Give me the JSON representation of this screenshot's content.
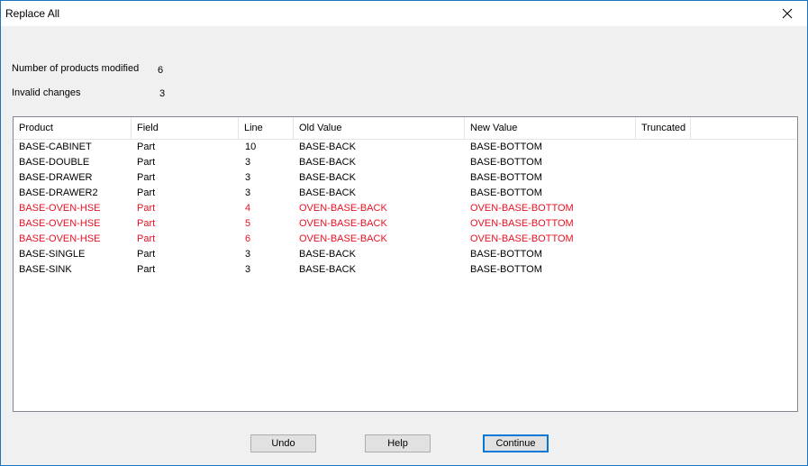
{
  "window": {
    "title": "Replace All"
  },
  "summary": {
    "modified_label": "Number of products modified",
    "modified_value": "6",
    "invalid_label": "Invalid changes",
    "invalid_value": "3"
  },
  "table": {
    "columns": [
      "Product",
      "Field",
      "Line",
      "Old Value",
      "New Value",
      "Truncated"
    ],
    "rows": [
      {
        "product": "BASE-CABINET",
        "field": "Part",
        "line": "10",
        "old": "BASE-BACK",
        "new": "BASE-BOTTOM",
        "truncated": "",
        "invalid": false
      },
      {
        "product": "BASE-DOUBLE",
        "field": "Part",
        "line": "3",
        "old": "BASE-BACK",
        "new": "BASE-BOTTOM",
        "truncated": "",
        "invalid": false
      },
      {
        "product": "BASE-DRAWER",
        "field": "Part",
        "line": "3",
        "old": "BASE-BACK",
        "new": "BASE-BOTTOM",
        "truncated": "",
        "invalid": false
      },
      {
        "product": "BASE-DRAWER2",
        "field": "Part",
        "line": "3",
        "old": "BASE-BACK",
        "new": "BASE-BOTTOM",
        "truncated": "",
        "invalid": false
      },
      {
        "product": "BASE-OVEN-HSE",
        "field": "Part",
        "line": "4",
        "old": "OVEN-BASE-BACK",
        "new": "OVEN-BASE-BOTTOM",
        "truncated": "",
        "invalid": true
      },
      {
        "product": "BASE-OVEN-HSE",
        "field": "Part",
        "line": "5",
        "old": "OVEN-BASE-BACK",
        "new": "OVEN-BASE-BOTTOM",
        "truncated": "",
        "invalid": true
      },
      {
        "product": "BASE-OVEN-HSE",
        "field": "Part",
        "line": "6",
        "old": "OVEN-BASE-BACK",
        "new": "OVEN-BASE-BOTTOM",
        "truncated": "",
        "invalid": true
      },
      {
        "product": "BASE-SINGLE",
        "field": "Part",
        "line": "3",
        "old": "BASE-BACK",
        "new": "BASE-BOTTOM",
        "truncated": "",
        "invalid": false
      },
      {
        "product": "BASE-SINK",
        "field": "Part",
        "line": "3",
        "old": "BASE-BACK",
        "new": "BASE-BOTTOM",
        "truncated": "",
        "invalid": false
      }
    ]
  },
  "buttons": {
    "undo": "Undo",
    "help": "Help",
    "continue": "Continue"
  },
  "colors": {
    "invalid_row": "#e81123",
    "default_button_border": "#0078d7"
  },
  "icons": {
    "close": "close-icon"
  }
}
